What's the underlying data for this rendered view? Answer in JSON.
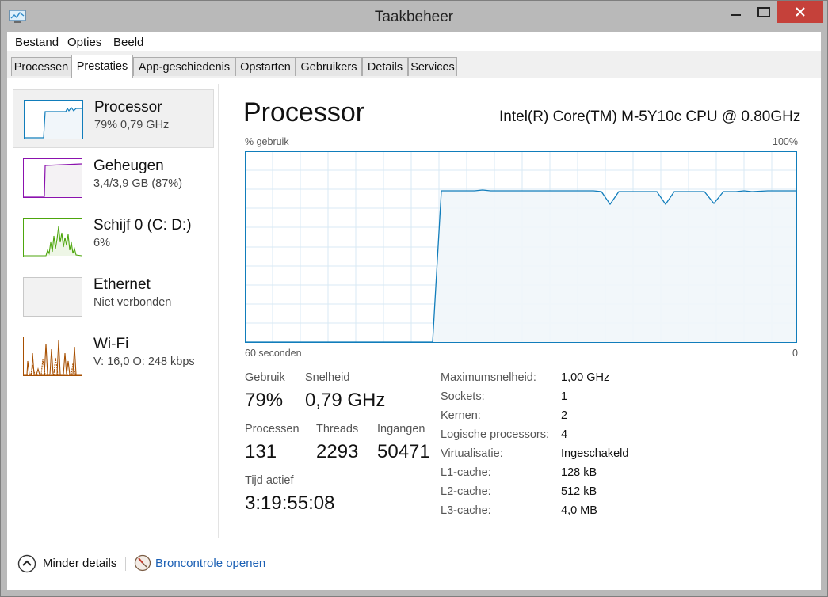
{
  "window": {
    "title": "Taakbeheer",
    "icon": "task-manager-icon"
  },
  "menu": {
    "items": [
      "Bestand",
      "Opties",
      "Beeld"
    ]
  },
  "tabs": [
    {
      "label": "Processen",
      "active": false
    },
    {
      "label": "Prestaties",
      "active": true
    },
    {
      "label": "App-geschiedenis",
      "active": false
    },
    {
      "label": "Opstarten",
      "active": false
    },
    {
      "label": "Gebruikers",
      "active": false
    },
    {
      "label": "Details",
      "active": false
    },
    {
      "label": "Services",
      "active": false
    }
  ],
  "sidebar": {
    "entries": [
      {
        "title": "Processor",
        "sub": "79%  0,79 GHz",
        "color": "#117dbb",
        "selected": true
      },
      {
        "title": "Geheugen",
        "sub": "3,4/3,9 GB (87%)",
        "color": "#8b12ae",
        "selected": false
      },
      {
        "title": "Schijf 0 (C: D:)",
        "sub": "6%",
        "color": "#4da60c",
        "selected": false
      },
      {
        "title": "Ethernet",
        "sub": "Niet verbonden",
        "color": "#9b9b9b",
        "selected": false
      },
      {
        "title": "Wi-Fi",
        "sub_v_label": "V:",
        "sub_v_value": "16,0",
        "sub_o_label": "O:",
        "sub_o_value": "248 kbps",
        "color": "#a74f01",
        "selected": false
      }
    ]
  },
  "main": {
    "title": "Processor",
    "cpu_name": "Intel(R) Core(TM) M-5Y10c CPU @ 0.80GHz",
    "graph": {
      "y_label": "% gebruik",
      "y_max_label": "100%",
      "x_left_label": "60 seconden",
      "x_right_label": "0",
      "line_color": "#117dbb",
      "fill_color": "#f1f6fa",
      "grid_color": "#d9eaf4"
    },
    "stats": {
      "usage_label": "Gebruik",
      "usage_value": "79%",
      "speed_label": "Snelheid",
      "speed_value": "0,79 GHz",
      "processes_label": "Processen",
      "processes_value": "131",
      "threads_label": "Threads",
      "threads_value": "2293",
      "handles_label": "Ingangen",
      "handles_value": "50471",
      "uptime_label": "Tijd actief",
      "uptime_value": "3:19:55:08"
    },
    "specs": [
      {
        "key": "Maximumsnelheid:",
        "value": "1,00 GHz"
      },
      {
        "key": "Sockets:",
        "value": "1"
      },
      {
        "key": "Kernen:",
        "value": "2"
      },
      {
        "key": "Logische processors:",
        "value": "4"
      },
      {
        "key": "Virtualisatie:",
        "value": "Ingeschakeld"
      },
      {
        "key": "L1-cache:",
        "value": "128 kB"
      },
      {
        "key": "L2-cache:",
        "value": "512 kB"
      },
      {
        "key": "L3-cache:",
        "value": "4,0 MB"
      }
    ]
  },
  "footer": {
    "less_details": "Minder details",
    "resource_monitor": "Broncontrole openen"
  }
}
